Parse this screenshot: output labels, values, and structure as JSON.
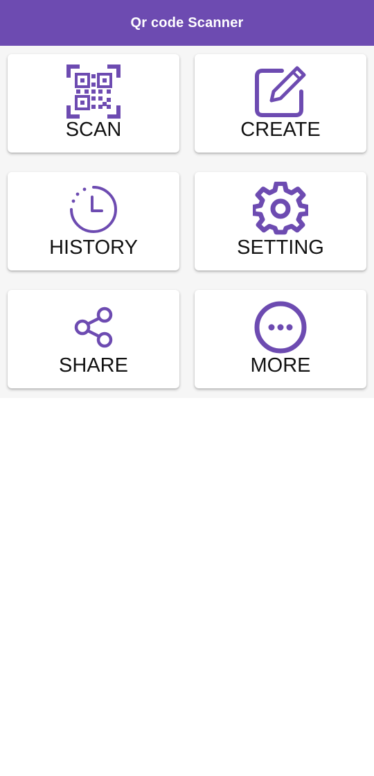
{
  "app_bar": {
    "title": "Qr code Scanner",
    "color": "#6d4bb1"
  },
  "theme": {
    "accent": "#6d4bb1",
    "label_color": "#111111",
    "background": "#f6f6f6"
  },
  "menu": {
    "items": [
      {
        "label": "SCAN",
        "icon": "qr-code-icon"
      },
      {
        "label": "CREATE",
        "icon": "edit-icon"
      },
      {
        "label": "HISTORY",
        "icon": "history-icon"
      },
      {
        "label": "SETTING",
        "icon": "gear-icon"
      },
      {
        "label": "SHARE",
        "icon": "share-icon"
      },
      {
        "label": "MORE",
        "icon": "more-icon"
      }
    ]
  }
}
